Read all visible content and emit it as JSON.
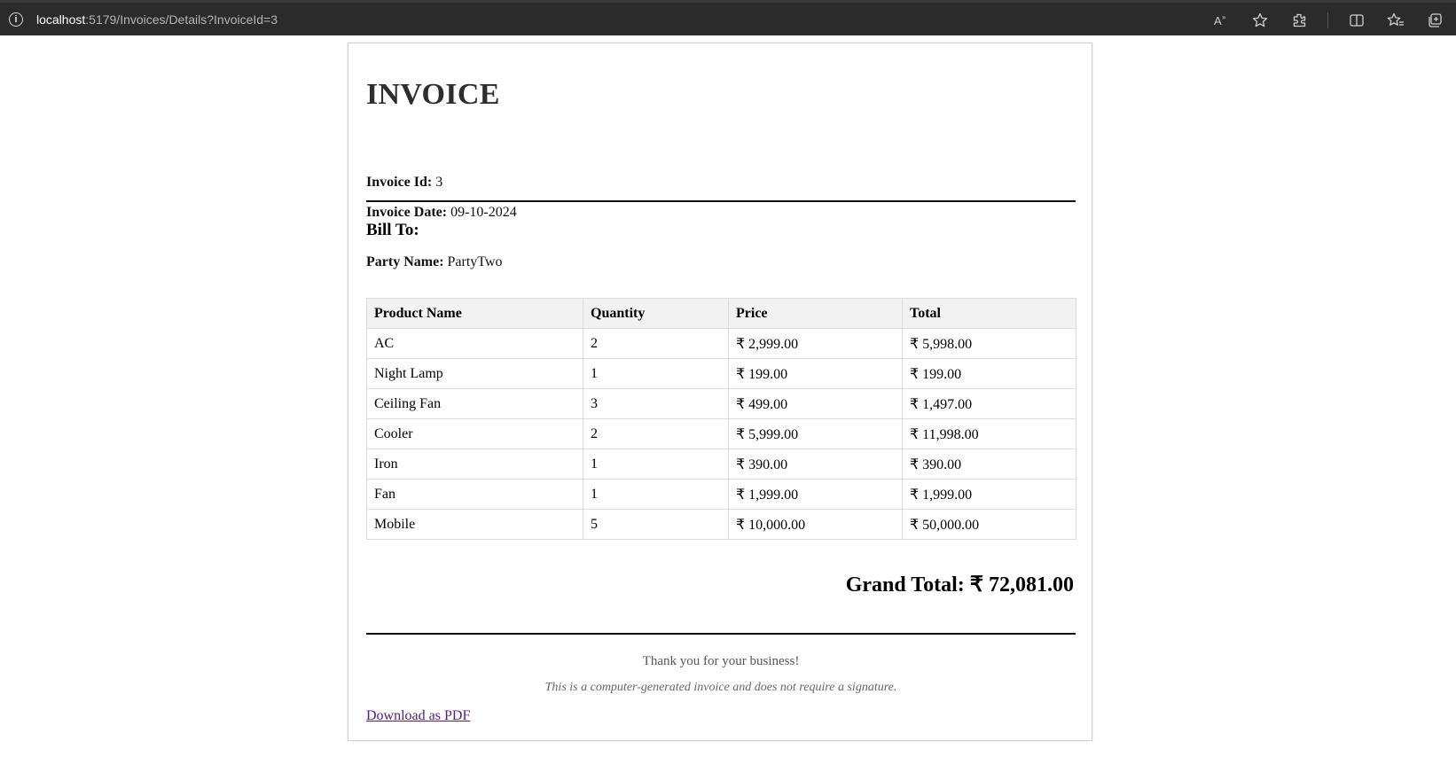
{
  "browser": {
    "url_host": "localhost",
    "url_rest": ":5179/Invoices/Details?InvoiceId=3",
    "icons": [
      "info-icon",
      "read-aloud-icon",
      "favorite-star-icon",
      "extensions-icon",
      "split-screen-icon",
      "favorites-icon",
      "collections-icon"
    ]
  },
  "invoice": {
    "title": "INVOICE",
    "id_label": "Invoice Id:",
    "id_value": "3",
    "date_label": "Invoice Date:",
    "date_value": "09-10-2024",
    "bill_to": "Bill To:",
    "party_label": "Party Name:",
    "party_value": "PartyTwo",
    "columns": [
      "Product Name",
      "Quantity",
      "Price",
      "Total"
    ],
    "rows": [
      [
        "AC",
        "2",
        "₹ 2,999.00",
        "₹ 5,998.00"
      ],
      [
        "Night Lamp",
        "1",
        "₹ 199.00",
        "₹ 199.00"
      ],
      [
        "Ceiling Fan",
        "3",
        "₹ 499.00",
        "₹ 1,497.00"
      ],
      [
        "Cooler",
        "2",
        "₹ 5,999.00",
        "₹ 11,998.00"
      ],
      [
        "Iron",
        "1",
        "₹ 390.00",
        "₹ 390.00"
      ],
      [
        "Fan",
        "1",
        "₹ 1,999.00",
        "₹ 1,999.00"
      ],
      [
        "Mobile",
        "5",
        "₹ 10,000.00",
        "₹ 50,000.00"
      ]
    ],
    "grand_total": "Grand Total: ₹ 72,081.00",
    "thanks": "Thank you for your business!",
    "disclaimer": "This is a computer-generated invoice and does not require a signature.",
    "download_link": "Download as PDF"
  }
}
